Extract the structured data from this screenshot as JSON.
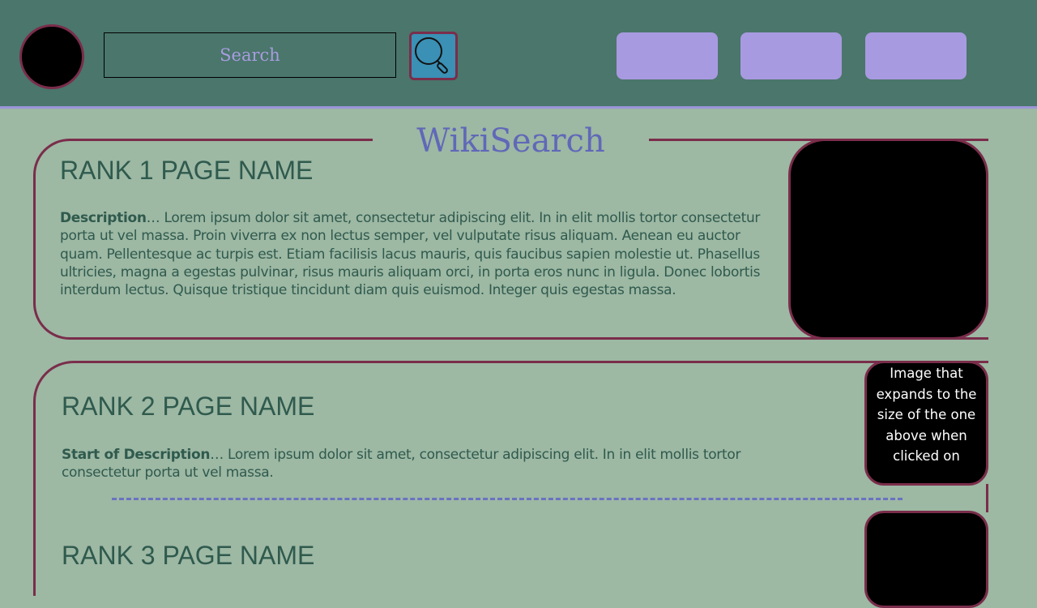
{
  "header": {
    "search_placeholder": "Search",
    "search_icon": "magnifier-icon",
    "nav_buttons": [
      "",
      "",
      ""
    ]
  },
  "title": "WikiSearch",
  "results": [
    {
      "title": "RANK 1 PAGE NAME",
      "desc_label": "Description",
      "desc_text": "… Lorem ipsum dolor sit amet, consectetur adipiscing elit. In in elit mollis tortor consectetur porta ut vel massa. Proin viverra ex non lectus semper, vel vulputate risus aliquam. Aenean eu auctor quam. Pellentesque ac turpis est. Etiam facilisis lacus mauris, quis faucibus sapien molestie ut. Phasellus ultricies, magna a egestas pulvinar, risus mauris aliquam orci, in porta eros nunc in ligula. Donec lobortis interdum lectus. Quisque tristique tincidunt diam quis euismod. Integer quis egestas massa."
    },
    {
      "title": "RANK 2 PAGE NAME",
      "desc_label": "Start of Description",
      "desc_text": "… Lorem ipsum dolor sit amet, consectetur adipiscing elit. In in elit mollis tortor consectetur porta ut vel massa.",
      "image_note": "Image that expands to the size of the one above when clicked on"
    },
    {
      "title": "RANK 3 PAGE NAME"
    }
  ],
  "colors": {
    "header_bg": "#4a766b",
    "page_bg": "#9db8a3",
    "accent": "#7a2d4b",
    "nav_button": "#a89ae0",
    "title": "#6068b8"
  }
}
